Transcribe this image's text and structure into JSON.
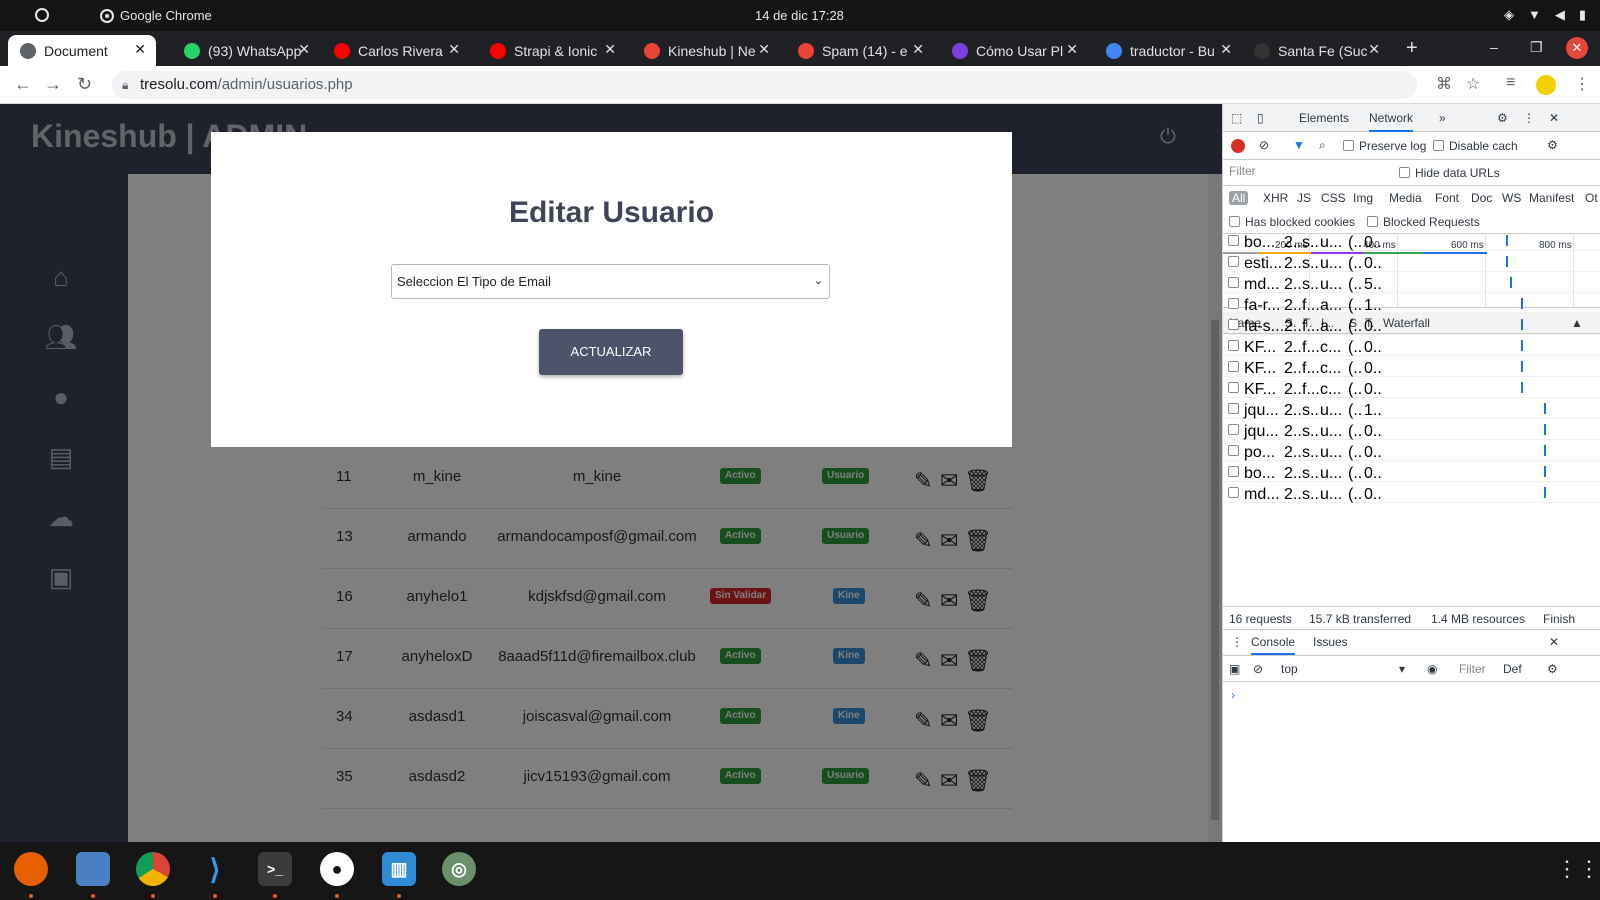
{
  "os": {
    "app_name": "Google Chrome",
    "clock": "14 de dic  17:28"
  },
  "browser": {
    "tabs": [
      {
        "title": "Document",
        "icon": "globe-icon",
        "color": "#5f6368",
        "active": true
      },
      {
        "title": "(93) WhatsApp",
        "icon": "whatsapp-icon",
        "color": "#25d366"
      },
      {
        "title": "Carlos Rivera",
        "icon": "youtube-icon",
        "color": "#ff0000"
      },
      {
        "title": "Strapi & Ionic",
        "icon": "youtube-icon",
        "color": "#ff0000"
      },
      {
        "title": "Kineshub | Ne",
        "icon": "gmail-icon",
        "color": "#ea4335"
      },
      {
        "title": "Spam (14) - e",
        "icon": "gmail-icon",
        "color": "#ea4335"
      },
      {
        "title": "Cómo Usar Pl",
        "icon": "bookmark-icon",
        "color": "#7b3fe4"
      },
      {
        "title": "traductor - Bu",
        "icon": "google-icon",
        "color": "#4285f4"
      },
      {
        "title": "Santa Fe (Suc",
        "icon": "wikipedia-icon",
        "color": "#333333"
      }
    ],
    "url_host": "tresolu.com",
    "url_path": "/admin/usuarios.php"
  },
  "page": {
    "brand": "Kineshub | ADMIN",
    "watermark": "Kineshub",
    "rows": [
      {
        "id": "11",
        "user": "m_kine",
        "email": "m_kine",
        "status": "Activo",
        "role": "Usuario"
      },
      {
        "id": "13",
        "user": "armando",
        "email": "armandocamposf@gmail.com",
        "status": "Activo",
        "role": "Usuario"
      },
      {
        "id": "16",
        "user": "anyhelo1",
        "email": "kdjskfsd@gmail.com",
        "status": "Sin Validar",
        "role": "Kine"
      },
      {
        "id": "17",
        "user": "anyheloxD",
        "email": "8aaad5f11d@firemailbox.club",
        "status": "Activo",
        "role": "Kine"
      },
      {
        "id": "34",
        "user": "asdasd1",
        "email": "joiscasval@gmail.com",
        "status": "Activo",
        "role": "Kine"
      },
      {
        "id": "35",
        "user": "asdasd2",
        "email": "jicv15193@gmail.com",
        "status": "Activo",
        "role": "Usuario"
      }
    ],
    "colors": {
      "status_active": "#2e9c3c",
      "status_unvalidated": "#d9262b",
      "role_user": "#2e9c3c",
      "role_kine": "#3b8fd4"
    }
  },
  "modal": {
    "title": "Editar Usuario",
    "select_value": "Seleccion El Tipo de Email",
    "button_label": "ACTUALIZAR"
  },
  "devtools": {
    "tab_elements": "Elements",
    "tab_network": "Network",
    "preserve_log": "Preserve log",
    "disable_cache": "Disable cach",
    "filter_placeholder": "Filter",
    "hide_data_urls": "Hide data URLs",
    "types": [
      "All",
      "XHR",
      "JS",
      "CSS",
      "Img",
      "Media",
      "Font",
      "Doc",
      "WS",
      "Manifest",
      "Ot"
    ],
    "has_blocked_cookies": "Has blocked cookies",
    "blocked_requests": "Blocked Requests",
    "timeline_labels": [
      "200 ms",
      "400 ms",
      "600 ms",
      "800 ms"
    ],
    "columns": [
      "Name",
      "S.",
      "T.",
      "I...",
      "S",
      "T.",
      "Waterfall"
    ],
    "requests": [
      {
        "name": "bo...",
        "s": "2..",
        "t": "s..",
        "i": "u...",
        "sz": "(..",
        "tm": "0..",
        "w": 0.73
      },
      {
        "name": "esti...",
        "s": "2..",
        "t": "s..",
        "i": "u...",
        "sz": "(..",
        "tm": "0..",
        "w": 0.73
      },
      {
        "name": "md...",
        "s": "2..",
        "t": "s..",
        "i": "u...",
        "sz": "(..",
        "tm": "5..",
        "w": 0.75
      },
      {
        "name": "fa-r...",
        "s": "2..",
        "t": "f...",
        "i": "a...",
        "sz": "(..",
        "tm": "1..",
        "w": 0.82
      },
      {
        "name": "fa-s...",
        "s": "2..",
        "t": "f...",
        "i": "a...",
        "sz": "(..",
        "tm": "0..",
        "w": 0.82
      },
      {
        "name": "KF...",
        "s": "2..",
        "t": "f...",
        "i": "c...",
        "sz": "(..",
        "tm": "0..",
        "w": 0.82
      },
      {
        "name": "KF...",
        "s": "2..",
        "t": "f...",
        "i": "c...",
        "sz": "(..",
        "tm": "0..",
        "w": 0.82
      },
      {
        "name": "KF...",
        "s": "2..",
        "t": "f...",
        "i": "c...",
        "sz": "(..",
        "tm": "0..",
        "w": 0.82
      },
      {
        "name": "jqu...",
        "s": "2..",
        "t": "s..",
        "i": "u...",
        "sz": "(..",
        "tm": "1..",
        "w": 0.95
      },
      {
        "name": "jqu...",
        "s": "2..",
        "t": "s..",
        "i": "u...",
        "sz": "(..",
        "tm": "0..",
        "w": 0.95
      },
      {
        "name": "po...",
        "s": "2..",
        "t": "s..",
        "i": "u...",
        "sz": "(..",
        "tm": "0..",
        "w": 0.95
      },
      {
        "name": "bo...",
        "s": "2..",
        "t": "s..",
        "i": "u...",
        "sz": "(..",
        "tm": "0..",
        "w": 0.95
      },
      {
        "name": "md...",
        "s": "2..",
        "t": "s..",
        "i": "u...",
        "sz": "(..",
        "tm": "0..",
        "w": 0.95
      }
    ],
    "summary_requests": "16 requests",
    "summary_transferred": "15.7 kB transferred",
    "summary_resources": "1.4 MB resources",
    "summary_finish": "Finish",
    "console_tab": "Console",
    "issues_tab": "Issues",
    "context": "top",
    "console_filter": "Filter",
    "console_levels": "Def"
  }
}
